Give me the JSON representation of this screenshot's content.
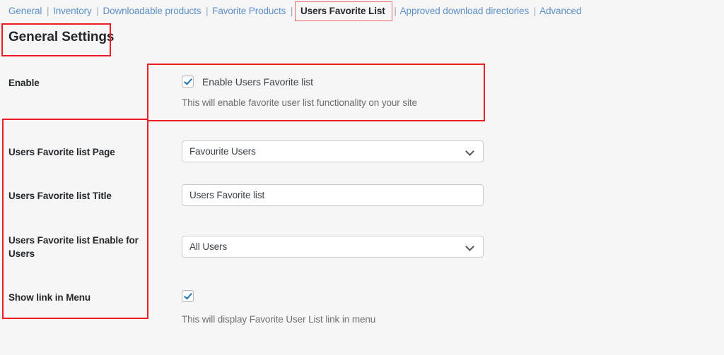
{
  "tabs": [
    {
      "label": "General",
      "active": false
    },
    {
      "label": "Inventory",
      "active": false
    },
    {
      "label": "Downloadable products",
      "active": false
    },
    {
      "label": "Favorite Products",
      "active": false
    },
    {
      "label": "Users Favorite List",
      "active": true
    },
    {
      "label": "Approved download directories",
      "active": false
    },
    {
      "label": "Advanced",
      "active": false
    }
  ],
  "tab_separator": "|",
  "section": {
    "heading": "General Settings"
  },
  "rows": {
    "enable": {
      "label": "Enable",
      "checkbox_label": "Enable Users Favorite list",
      "checked": true,
      "help": "This will enable favorite user list functionality on your site"
    },
    "page": {
      "label": "Users Favorite list Page",
      "value": "Favourite Users",
      "control": "select"
    },
    "title": {
      "label": "Users Favorite list Title",
      "value": "Users Favorite list",
      "placeholder": "Users Favorite list",
      "control": "text"
    },
    "enable_for_users": {
      "label": "Users Favorite list Enable for Users",
      "value": "All Users",
      "control": "select"
    },
    "show_link": {
      "label": "Show link in Menu",
      "checked": true,
      "help": "This will display Favorite User List link in menu"
    }
  },
  "colors": {
    "annotation": "#ee1c25",
    "link": "#5b8fc9",
    "checkmark": "#2271b1",
    "background": "#f6f6f6"
  },
  "icons": {
    "chevron": "chevron-down-icon",
    "check": "checkmark-icon"
  }
}
